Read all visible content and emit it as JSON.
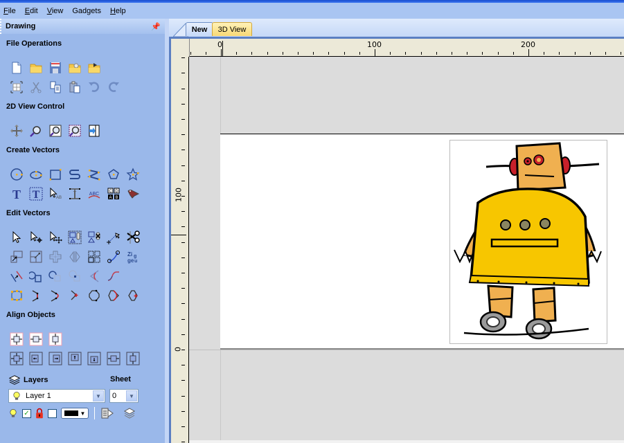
{
  "menubar": {
    "items": [
      {
        "label": "File",
        "accel": "F",
        "rest": "ile"
      },
      {
        "label": "Edit",
        "accel": "E",
        "rest": "dit"
      },
      {
        "label": "View",
        "accel": "V",
        "rest": "iew"
      },
      {
        "label": "Gadgets",
        "accel": "",
        "rest": "Gadgets"
      },
      {
        "label": "Help",
        "accel": "H",
        "rest": "elp"
      }
    ]
  },
  "sidebar": {
    "title": "Drawing",
    "pin_icon": "pin-icon",
    "sections": {
      "file_operations": "File Operations",
      "view_control": "2D View Control",
      "create_vectors": "Create Vectors",
      "edit_vectors": "Edit Vectors",
      "align_objects": "Align Objects"
    },
    "file_ops_row1": [
      "new-file-icon",
      "open-file-icon",
      "save-file-icon",
      "open-folder-icon",
      "import-icon"
    ],
    "file_ops_row2": [
      "select-all-icon",
      "cut-icon",
      "copy-icon",
      "paste-icon",
      "undo-icon",
      "redo-icon"
    ],
    "view_control": [
      "pan-icon",
      "zoom-box-icon",
      "zoom-extents-icon",
      "zoom-selection-icon",
      "fit-page-icon"
    ],
    "create_row1": [
      "circle-icon",
      "ellipse-icon",
      "rectangle-icon",
      "polyline-s-icon",
      "polyline-z-icon",
      "polygon-icon",
      "star-icon"
    ],
    "create_row2": [
      "text-icon",
      "text-box-icon",
      "text-on-curve-icon",
      "text-edit-icon",
      "arc-text-icon",
      "grid-text-icon",
      "bitmap-trace-icon"
    ],
    "layers": {
      "label": "Layers",
      "sheet_label": "Sheet",
      "current_layer": "Layer 1",
      "current_sheet": "0",
      "layer_visible": true,
      "layer_locked": true
    }
  },
  "tabs": [
    {
      "label": "New",
      "active": true
    },
    {
      "label": "3D View",
      "active": false
    }
  ],
  "rulers": {
    "horizontal_labels": [
      "0",
      "100",
      "200"
    ],
    "vertical_labels": [
      "100",
      "0"
    ]
  },
  "colors": {
    "sidebar_bg": "#9ab8ea",
    "menubar_bg": "#a9c5f2",
    "ruler_bg": "#ece9d8",
    "canvas_bg": "#dcdcdc",
    "tab_3d_bg": "#f8d874",
    "robot_body": "#f7c600",
    "robot_limbs": "#f0b050",
    "robot_accent": "#c8202a"
  }
}
